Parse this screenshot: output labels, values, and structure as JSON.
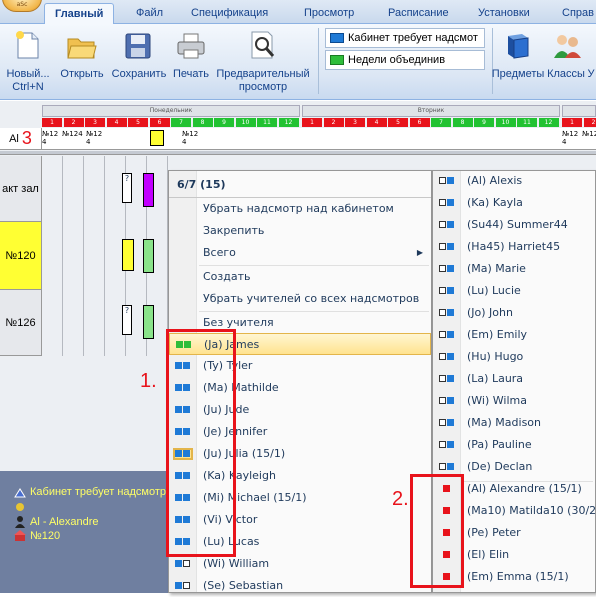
{
  "app": {
    "orb_label": "aSc"
  },
  "tabs": [
    "Главный",
    "Файл",
    "Спецификация",
    "Просмотр",
    "Расписание",
    "Установки",
    "Справ"
  ],
  "toolbar": {
    "new_label": "Новый...",
    "new_shortcut": "Ctrl+N",
    "open_label": "Открыть",
    "save_label": "Сохранить",
    "print_label": "Печать",
    "preview_label_1": "Предварительный",
    "preview_label_2": "просмотр",
    "combo1": "Кабинет требует надсмот",
    "combo2": "Недели объединив",
    "subjects_label": "Предметы",
    "classes_label": "Классы",
    "more_label": "У"
  },
  "grid": {
    "day1": "Понедельник",
    "day2": "Вторник",
    "periods": [
      "1",
      "2",
      "3",
      "4",
      "5",
      "6",
      "7",
      "8",
      "9",
      "10",
      "11",
      "12"
    ],
    "al_row_label": "Al",
    "al_number": "3",
    "mini_cards": [
      "№12 4",
      "№124",
      "№12 4",
      "№12 4",
      "№12 4",
      "№124"
    ],
    "rows": [
      {
        "label": "акт зал"
      },
      {
        "label": "№120"
      },
      {
        "label": "№126"
      }
    ],
    "card_q": "?"
  },
  "info_panel": {
    "line1": "Кабинет требует надсмотр",
    "line2": "Al - Alexandre",
    "line3": "№120"
  },
  "menu1": {
    "header": "6/7 (15)",
    "items_top": [
      "Убрать надсмотр над кабинетом",
      "Закрепить",
      "Всего"
    ],
    "items_mid": [
      "Создать",
      "Убрать учителей со всех надсмотров"
    ],
    "items_bottom": [
      "Без учителя"
    ],
    "teachers": [
      "(Ja) James",
      "(Ty) Tyler",
      "(Ma) Mathilde",
      "(Ju) Jude",
      "(Je) Jennifer",
      "(Ju) Julia (15/1)",
      "(Ka) Kayleigh",
      "(Mi) Michael (15/1)",
      "(Vi) Victor",
      "(Lu) Lucas",
      "(Wi) William",
      "(Se) Sebastian"
    ]
  },
  "menu2": {
    "teachers": [
      "(Al) Alexis",
      "(Ka) Kayla",
      "(Su44) Summer44",
      "(Ha45) Harriet45",
      "(Ma) Marie",
      "(Lu) Lucie",
      "(Jo) John",
      "(Em) Emily",
      "(Hu) Hugo",
      "(La) Laura",
      "(Wi) Wilma",
      "(Ma) Madison",
      "(Pa) Pauline",
      "(De) Declan"
    ],
    "busy": [
      "(Al) Alexandre (15/1)",
      "(Ma10) Matilda10 (30/2)",
      "(Pe) Peter",
      "(El) Elin",
      "(Em) Emma (15/1)"
    ]
  },
  "annotations": {
    "n1": "1.",
    "n2": "2."
  },
  "colors": {
    "accent": "#15428b",
    "red": "#e8131b",
    "blue_icon": "#1f7ad6",
    "green_icon": "#2fbd3a",
    "yellow": "#ffff33",
    "green_card": "#8ae48a",
    "magenta": "#c200ff"
  }
}
